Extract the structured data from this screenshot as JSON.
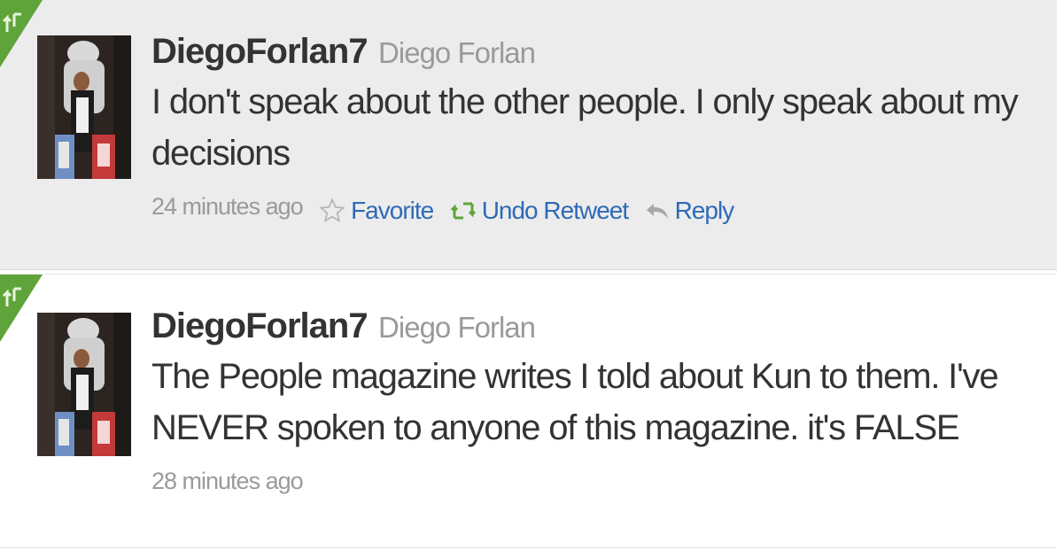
{
  "tweets": [
    {
      "screen_name": "DiegoForlan7",
      "full_name": "Diego Forlan",
      "text": "I don't speak about the other people. I only speak about my decisions",
      "timestamp": "24 minutes ago",
      "actions": {
        "favorite": "Favorite",
        "undo_retweet": "Undo Retweet",
        "reply": "Reply"
      }
    },
    {
      "screen_name": "DiegoForlan7",
      "full_name": "Diego Forlan",
      "text": "The People magazine writes I told about Kun to them. I've NEVER spoken to anyone of this magazine. it's FALSE",
      "timestamp": "28 minutes ago"
    }
  ],
  "colors": {
    "retweet_badge": "#5fa43a",
    "link": "#2e6ab8",
    "text": "#333333",
    "muted": "#9a9a9a",
    "highlight_bg": "#ececec"
  },
  "icons": [
    "retweet-badge-icon",
    "star-icon",
    "retweet-icon",
    "reply-icon"
  ]
}
